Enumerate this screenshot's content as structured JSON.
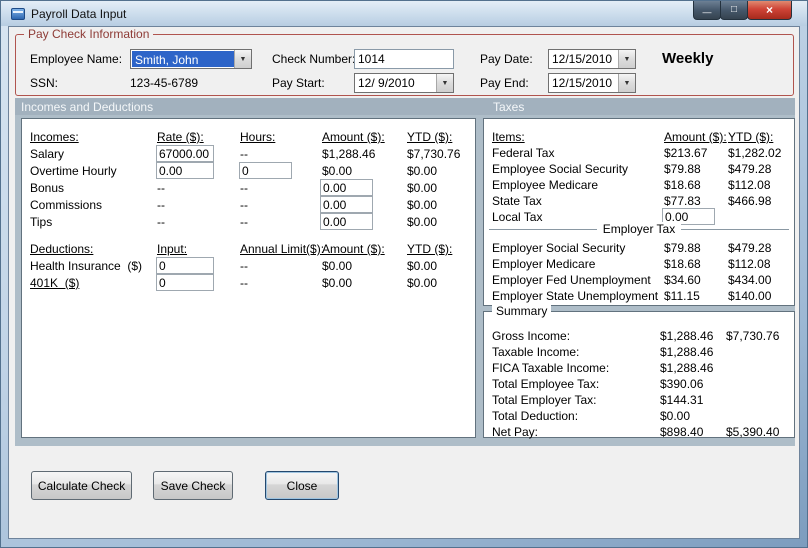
{
  "window": {
    "title": "Payroll Data Input"
  },
  "icons": {
    "minimize": "—",
    "maximize": "□",
    "close": "×",
    "dropdown": "▼"
  },
  "paycheck": {
    "group_title": "Pay Check Information",
    "employee_name_label": "Employee Name:",
    "employee_name_value": "Smith, John",
    "ssn_label": "SSN:",
    "ssn_value": "123-45-6789",
    "check_number_label": "Check Number:",
    "check_number_value": "1014",
    "pay_start_label": "Pay Start:",
    "pay_start_value": "12/ 9/2010",
    "pay_date_label": "Pay Date:",
    "pay_date_value": "12/15/2010",
    "pay_end_label": "Pay End:",
    "pay_end_value": "12/15/2010",
    "frequency": "Weekly"
  },
  "section_headers": {
    "left": "Incomes and Deductions",
    "right": "Taxes"
  },
  "incomes": {
    "headers": {
      "name": "Incomes:",
      "rate": "Rate ($):",
      "hours": "Hours:",
      "amount": "Amount ($):",
      "ytd": "YTD ($):"
    },
    "rows": [
      {
        "name": "Salary",
        "rate": "67000.00",
        "hours": "--",
        "amount": "$1,288.46",
        "ytd": "$7,730.76"
      },
      {
        "name": "Overtime Hourly",
        "rate": "0.00",
        "hours": "0",
        "amount": "$0.00",
        "ytd": "$0.00"
      },
      {
        "name": "Bonus",
        "rate": "--",
        "hours": "--",
        "amount": "0.00",
        "ytd": "$0.00"
      },
      {
        "name": "Commissions",
        "rate": "--",
        "hours": "--",
        "amount": "0.00",
        "ytd": "$0.00"
      },
      {
        "name": "Tips",
        "rate": "--",
        "hours": "--",
        "amount": "0.00",
        "ytd": "$0.00"
      }
    ]
  },
  "deductions": {
    "headers": {
      "name": "Deductions:",
      "input": "Input:",
      "limit": "Annual Limit($):",
      "amount": "Amount ($):",
      "ytd": "YTD ($):"
    },
    "rows": [
      {
        "name": "Health Insurance  ($)",
        "input": "0",
        "limit": "--",
        "amount": "$0.00",
        "ytd": "$0.00"
      },
      {
        "name": "401K  ($)",
        "input": "0",
        "limit": "--",
        "amount": "$0.00",
        "ytd": "$0.00"
      }
    ]
  },
  "taxes": {
    "headers": {
      "item": "Items:",
      "amount": "Amount ($):",
      "ytd": "YTD ($):"
    },
    "employee_rows": [
      {
        "item": "Federal Tax",
        "amount": "$213.67",
        "ytd": "$1,282.02"
      },
      {
        "item": "Employee Social Security",
        "amount": "$79.88",
        "ytd": "$479.28"
      },
      {
        "item": "Employee Medicare",
        "amount": "$18.68",
        "ytd": "$112.08"
      },
      {
        "item": "State Tax",
        "amount": "$77.83",
        "ytd": "$466.98"
      },
      {
        "item": "Local Tax",
        "amount": "0.00",
        "ytd": ""
      }
    ],
    "employer_divider": "Employer Tax",
    "employer_rows": [
      {
        "item": "Employer Social Security",
        "amount": "$79.88",
        "ytd": "$479.28"
      },
      {
        "item": "Employer Medicare",
        "amount": "$18.68",
        "ytd": "$112.08"
      },
      {
        "item": "Employer Fed Unemployment",
        "amount": "$34.60",
        "ytd": "$434.00"
      },
      {
        "item": "Employer State Unemployment",
        "amount": "$11.15",
        "ytd": "$140.00"
      }
    ]
  },
  "summary": {
    "group_title": "Summary",
    "rows": [
      {
        "label": "Gross Income:",
        "amount": "$1,288.46",
        "ytd": "$7,730.76"
      },
      {
        "label": "Taxable Income:",
        "amount": "$1,288.46",
        "ytd": ""
      },
      {
        "label": "FICA Taxable Income:",
        "amount": "$1,288.46",
        "ytd": ""
      },
      {
        "label": "Total Employee Tax:",
        "amount": "$390.06",
        "ytd": ""
      },
      {
        "label": "Total Employer Tax:",
        "amount": "$144.31",
        "ytd": ""
      },
      {
        "label": "Total Deduction:",
        "amount": "$0.00",
        "ytd": ""
      },
      {
        "label": "Net Pay:",
        "amount": "$898.40",
        "ytd": "$5,390.40"
      }
    ]
  },
  "buttons": {
    "calculate": "Calculate Check",
    "save": "Save Check",
    "close": "Close"
  },
  "colors": {
    "groupbox_border": "#b0544e",
    "selection_blue": "#2d64c8",
    "content_bg": "#aebdc8",
    "close_red": "#cf4437"
  }
}
